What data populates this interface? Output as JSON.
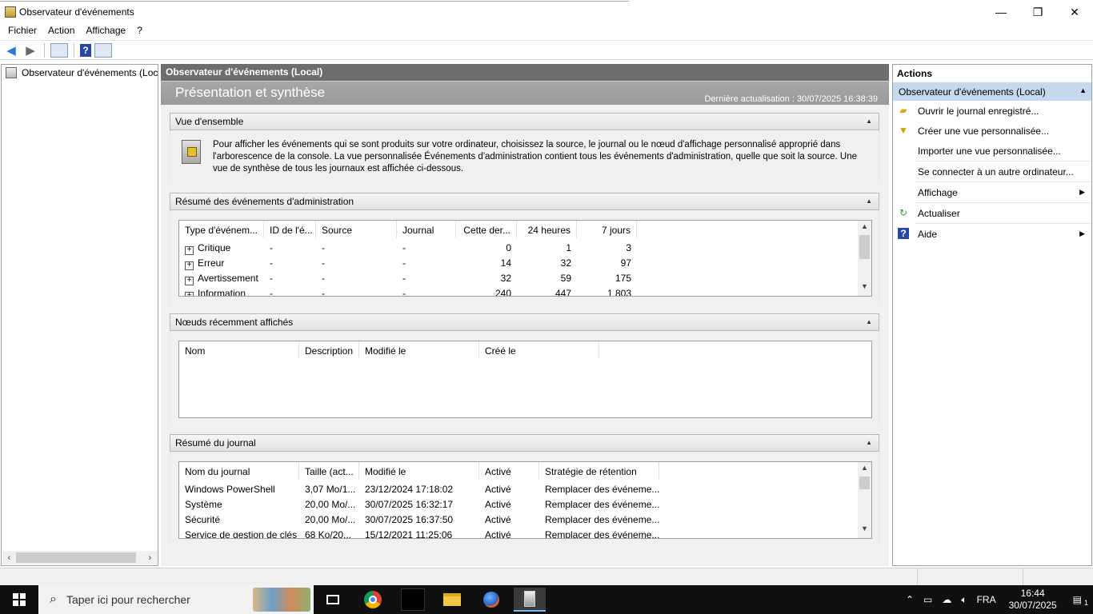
{
  "window": {
    "title": "Observateur d'événements",
    "minimize": "—",
    "maximize": "❐",
    "close": "✕"
  },
  "menu": [
    "Fichier",
    "Action",
    "Affichage",
    "?"
  ],
  "tree": {
    "root": "Observateur d'événements (Local)"
  },
  "center": {
    "header": "Observateur d'événements (Local)",
    "band_title": "Présentation et synthèse",
    "last_update": "Dernière actualisation : 30/07/2025 16:38:39",
    "overview": {
      "title": "Vue d'ensemble",
      "text": "Pour afficher les événements qui se sont produits sur votre ordinateur, choisissez la source, le journal ou le nœud d'affichage personnalisé approprié dans l'arborescence de la console. La vue personnalisée Événements d'administration contient tous les événements d'administration, quelle que soit la source. Une vue de synthèse de tous les journaux est affichée ci-dessous."
    },
    "admin_summary": {
      "title": "Résumé des événements d'administration",
      "columns": [
        "Type d'événem...",
        "ID de l'é...",
        "Source",
        "Journal",
        "Cette der...",
        "24 heures",
        "7 jours"
      ],
      "rows": [
        {
          "type": "Critique",
          "id": "-",
          "source": "-",
          "journal": "-",
          "last": "0",
          "h24": "1",
          "d7": "3"
        },
        {
          "type": "Erreur",
          "id": "-",
          "source": "-",
          "journal": "-",
          "last": "14",
          "h24": "32",
          "d7": "97"
        },
        {
          "type": "Avertissement",
          "id": "-",
          "source": "-",
          "journal": "-",
          "last": "32",
          "h24": "59",
          "d7": "175"
        },
        {
          "type": "Information",
          "id": "-",
          "source": "-",
          "journal": "-",
          "last": "240",
          "h24": "447",
          "d7": "1 803"
        }
      ]
    },
    "recent_nodes": {
      "title": "Nœuds récemment affichés",
      "columns": [
        "Nom",
        "Description",
        "Modifié le",
        "Créé le"
      ]
    },
    "log_summary": {
      "title": "Résumé du journal",
      "columns": [
        "Nom du journal",
        "Taille (act...",
        "Modifié le",
        "Activé",
        "Stratégie de rétention"
      ],
      "rows": [
        {
          "name": "Windows PowerShell",
          "size": "3,07 Mo/1...",
          "modified": "23/12/2024 17:18:02",
          "enabled": "Activé",
          "retention": "Remplacer des événeme..."
        },
        {
          "name": "Système",
          "size": "20,00 Mo/...",
          "modified": "30/07/2025 16:32:17",
          "enabled": "Activé",
          "retention": "Remplacer des événeme..."
        },
        {
          "name": "Sécurité",
          "size": "20,00 Mo/...",
          "modified": "30/07/2025 16:37:50",
          "enabled": "Activé",
          "retention": "Remplacer des événeme..."
        },
        {
          "name": "Service de gestion de clés",
          "size": "68 Ko/20...",
          "modified": "15/12/2021 11:25:06",
          "enabled": "Activé",
          "retention": "Remplacer des événeme..."
        }
      ]
    }
  },
  "actions": {
    "header": "Actions",
    "group": "Observateur d'événements (Local)",
    "items": [
      {
        "label": "Ouvrir le journal enregistré...",
        "icon": "folder-icon"
      },
      {
        "label": "Créer une vue personnalisée...",
        "icon": "filter-icon"
      },
      {
        "label": "Importer une vue personnalisée...",
        "icon": ""
      },
      {
        "label": "Se connecter à un autre ordinateur...",
        "icon": ""
      },
      {
        "label": "Affichage",
        "icon": ""
      },
      {
        "label": "Actualiser",
        "icon": "refresh-icon"
      },
      {
        "label": "Aide",
        "icon": "help-icon"
      }
    ]
  },
  "taskbar": {
    "search_placeholder": "Taper ici pour rechercher",
    "language": "FRA",
    "time": "16:44",
    "date": "30/07/2025",
    "notification_count": "1"
  }
}
